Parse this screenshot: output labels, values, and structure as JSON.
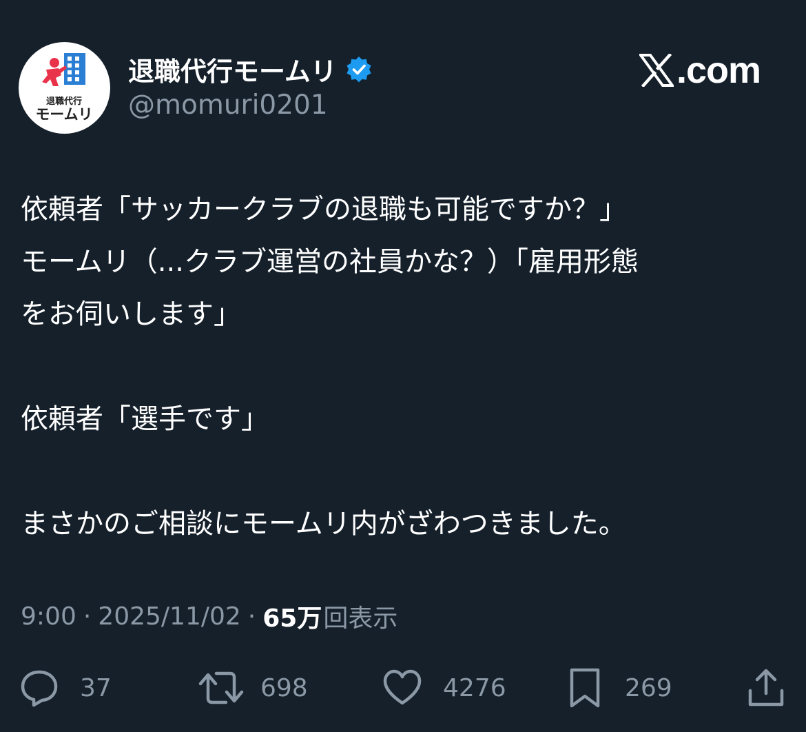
{
  "author": {
    "display_name": "退職代行モームリ",
    "handle": "@momuri0201",
    "verified_icon": "verified-badge-icon",
    "avatar_text_top": "退職代行",
    "avatar_text_bottom": "モームリ"
  },
  "brand": {
    "domain": ".com",
    "logo_icon": "x-logo-icon"
  },
  "tweet": {
    "lines": [
      "依頼者「サッカークラブの退職も可能ですか？」",
      "モームリ（...クラブ運営の社員かな？）「雇用形態",
      "をお伺いします」",
      "",
      "依頼者「選手です」",
      "",
      "まさかのご相談にモームリ内がざわつきました。"
    ]
  },
  "meta": {
    "time": "9:00",
    "separator": "·",
    "date": "2025/11/02",
    "views_count": "65万",
    "views_label": "回表示"
  },
  "actions": {
    "reply": {
      "icon": "reply-icon",
      "count": "37"
    },
    "retweet": {
      "icon": "retweet-icon",
      "count": "698"
    },
    "like": {
      "icon": "heart-icon",
      "count": "4276"
    },
    "bookmark": {
      "icon": "bookmark-icon",
      "count": "269"
    },
    "share": {
      "icon": "share-icon"
    }
  },
  "colors": {
    "background": "#15202b",
    "primary_text": "#ffffff",
    "secondary_text": "#8b98a5",
    "verified_blue": "#1d9bf0",
    "avatar_red": "#e8334a",
    "avatar_blue": "#2a7fd4"
  }
}
